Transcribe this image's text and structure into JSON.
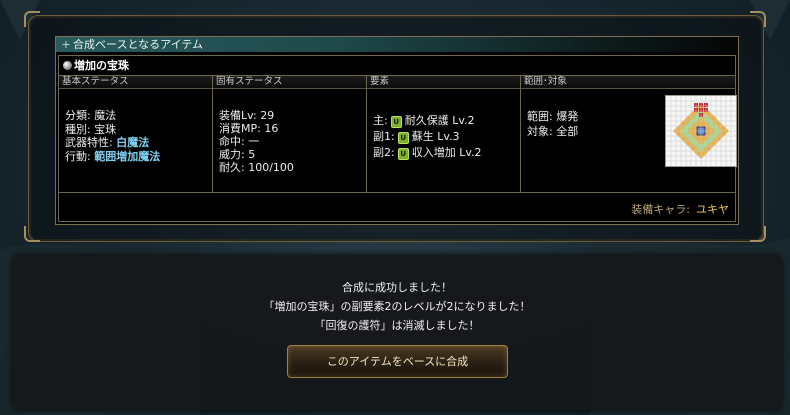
{
  "panel": {
    "caption": "合成ベースとなるアイテム",
    "item_name": "増加の宝珠",
    "columns": {
      "basic": {
        "header": "基本ステータス",
        "rows": [
          {
            "label": "分類:",
            "value": "魔法"
          },
          {
            "label": "種別:",
            "value": "宝珠"
          },
          {
            "label": "武器特性:",
            "value": "白魔法"
          },
          {
            "label": "行動:",
            "value": "範囲増加魔法"
          }
        ]
      },
      "unique": {
        "header": "固有ステータス",
        "rows": [
          {
            "label": "装備Lv:",
            "value": "29"
          },
          {
            "label": "消費MP:",
            "value": "16"
          },
          {
            "label": "命中:",
            "value": "一"
          },
          {
            "label": "威力:",
            "value": "5"
          },
          {
            "label": "耐久:",
            "value": "100/100"
          }
        ]
      },
      "elements": {
        "header": "要素",
        "rows": [
          {
            "label": "主:",
            "icon": "U",
            "value": "耐久保護 Lv.2"
          },
          {
            "label": "副1:",
            "icon": "U",
            "value": "蘇生 Lv.3"
          },
          {
            "label": "副2:",
            "icon": "U",
            "value": "収入増加 Lv.2"
          }
        ]
      },
      "range": {
        "header": "範囲･対象",
        "rows": [
          {
            "label": "範囲:",
            "value": "爆発"
          },
          {
            "label": "対象:",
            "value": "全部"
          }
        ]
      }
    },
    "equip": {
      "label": "装備キャラ:",
      "value": "ユキヤ"
    }
  },
  "dialog": {
    "line1": "合成に成功しました！",
    "line2": "「増加の宝珠」の副要素2のレベルが2になりました！",
    "line3": "「回復の護符」は消滅しました！",
    "button": "このアイテムをベースに合成"
  },
  "colors": {
    "highlight": "#7fd0f0",
    "equip_value": "#e8cb4a",
    "caption_bar": "#2a5c5e"
  }
}
